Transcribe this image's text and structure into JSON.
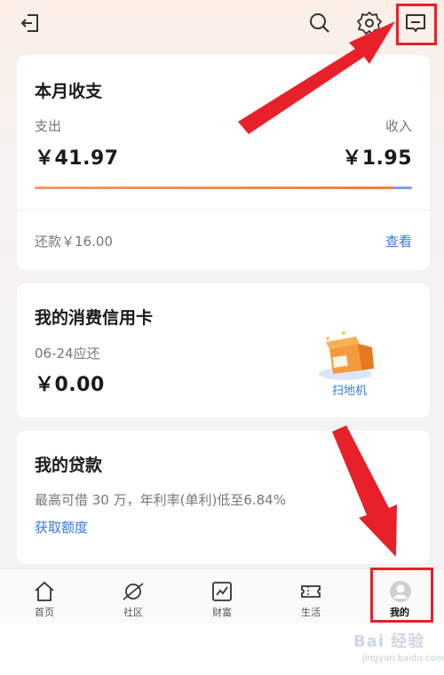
{
  "summary_card": {
    "title": "本月收支",
    "expense_label": "支出",
    "expense_value": "￥41.97",
    "income_label": "收入",
    "income_value": "￥1.95",
    "expense_share": 0.95,
    "repay_text": "还款￥16.00",
    "view_link": "查看"
  },
  "credit_card": {
    "title": "我的消费信用卡",
    "due_label": "06-24应还",
    "due_amount": "￥0.00",
    "promo_label": "扫地机"
  },
  "loan_card": {
    "title": "我的贷款",
    "desc": "最高可借 30 万，年利率(单利)低至6.84%",
    "link": "获取额度"
  },
  "tabs": [
    {
      "label": "首页",
      "icon": "home-icon"
    },
    {
      "label": "社区",
      "icon": "planet-icon"
    },
    {
      "label": "财富",
      "icon": "chart-icon"
    },
    {
      "label": "生活",
      "icon": "ticket-icon"
    },
    {
      "label": "我的",
      "icon": "avatar-icon"
    }
  ],
  "watermark": {
    "text": "Bai 经验",
    "sub": "jingyan.baidu.com"
  },
  "colors": {
    "accent_orange": "#f5823b",
    "link_blue": "#3a78d8",
    "annotation_red": "#e8202a"
  }
}
